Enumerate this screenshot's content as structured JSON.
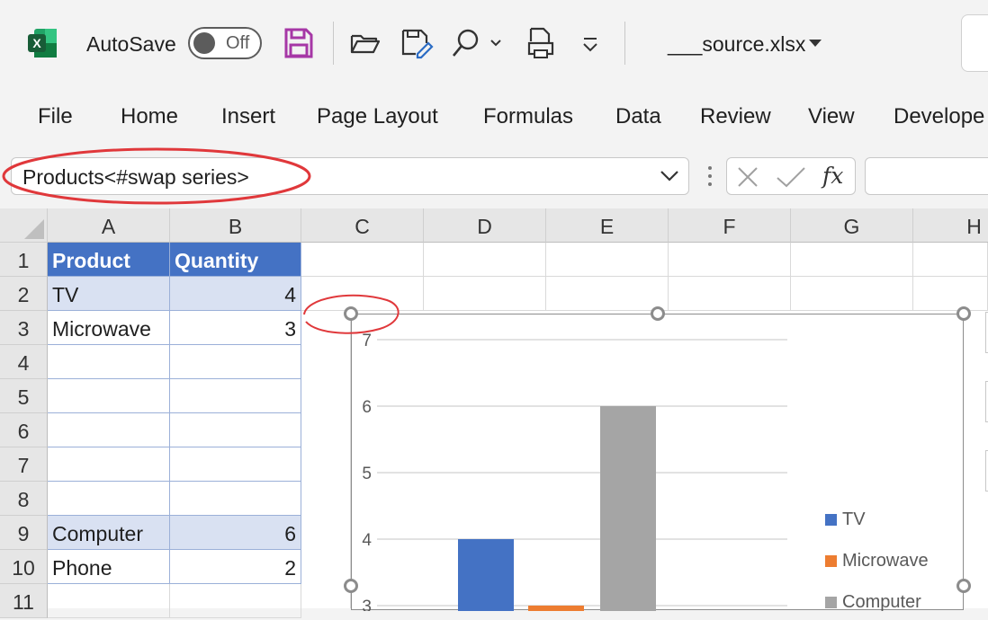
{
  "title_bar": {
    "autosave_label": "AutoSave",
    "autosave_state": "Off",
    "filename": "___source.xlsx"
  },
  "ribbon": {
    "tabs": [
      "File",
      "Home",
      "Insert",
      "Page Layout",
      "Formulas",
      "Data",
      "Review",
      "View",
      "Develope"
    ]
  },
  "formula_bar": {
    "name_box": "Products<#swap series>",
    "fx_label": "fx"
  },
  "grid": {
    "columns": [
      "A",
      "B",
      "C",
      "D",
      "E",
      "F",
      "G",
      "H"
    ],
    "rows": [
      "1",
      "2",
      "3",
      "4",
      "5",
      "6",
      "7",
      "8",
      "9",
      "10",
      "11"
    ],
    "cells": {
      "A1": "Product",
      "B1": "Quantity",
      "A2": "TV",
      "B2": "4",
      "A3": "Microwave",
      "B3": "3",
      "A9": "Computer",
      "B9": "6",
      "A10": "Phone",
      "B10": "2"
    }
  },
  "colors": {
    "table_header": "#4472c4",
    "table_band": "#d9e1f2",
    "annotation": "#e0383b",
    "save_icon": "#a637a6",
    "excel_green": "#107c41"
  },
  "chart_data": {
    "type": "bar",
    "categories": [
      "TV",
      "Microwave",
      "Computer"
    ],
    "series": [
      {
        "name": "TV",
        "values": [
          4
        ],
        "color": "#4472c4"
      },
      {
        "name": "Microwave",
        "values": [
          3
        ],
        "color": "#ed7d31"
      },
      {
        "name": "Computer",
        "values": [
          6
        ],
        "color": "#a5a5a5"
      }
    ],
    "y_ticks": [
      "3",
      "4",
      "5",
      "6",
      "7"
    ],
    "ylim": [
      0,
      7
    ],
    "grid": true,
    "legend_position": "right"
  }
}
